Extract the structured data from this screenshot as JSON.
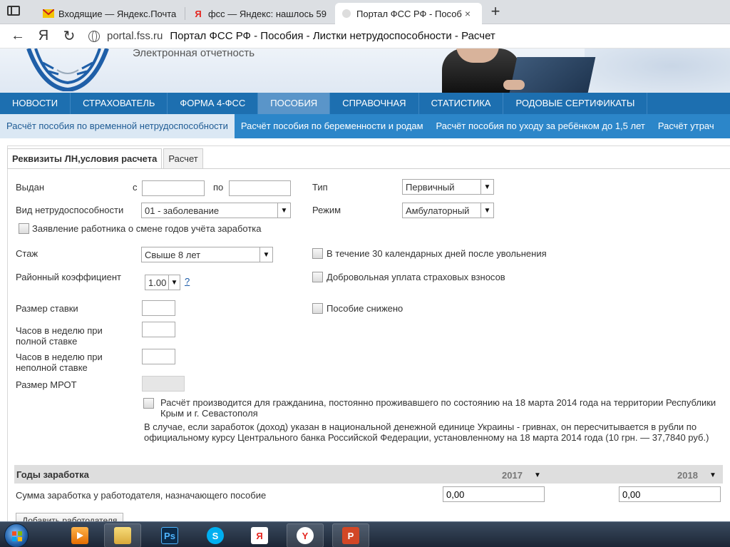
{
  "browser": {
    "tabs": [
      {
        "label": "Входящие — Яндекс.Почта",
        "icon": "yandex-mail-icon"
      },
      {
        "label": "фсс — Яндекс: нашлось 59",
        "icon": "yandex-icon"
      },
      {
        "label": "Портал ФСС РФ - Пособ",
        "icon": "page-icon",
        "close": "×"
      }
    ],
    "new_tab": "+",
    "yandex_button": "Я",
    "url_host": "portal.fss.ru",
    "page_title": "Портал ФСС РФ - Пособия - Листки нетрудоспособности - Расчет"
  },
  "site": {
    "subtitle": "Электронная отчетность"
  },
  "main_nav": [
    "НОВОСТИ",
    "СТРАХОВАТЕЛЬ",
    "ФОРМА 4-ФСС",
    "ПОСОБИЯ",
    "СПРАВОЧНАЯ",
    "СТАТИСТИКА",
    "РОДОВЫЕ СЕРТИФИКАТЫ"
  ],
  "sub_nav": [
    "Расчёт пособия по временной нетрудоспособности",
    "Расчёт пособия по беременности и родам",
    "Расчёт пособия по уходу за ребёнком до 1,5 лет",
    "Расчёт утрач"
  ],
  "form_tabs": [
    "Реквизиты ЛН,условия расчета",
    "Расчет"
  ],
  "form": {
    "issued_label": "Выдан",
    "from_label": "с",
    "to_label": "по",
    "from_value": "",
    "to_value": "",
    "type_label": "Тип",
    "type_value": "Первичный",
    "disability_label": "Вид нетрудоспособности",
    "disability_value": "01 - заболевание",
    "mode_label": "Режим",
    "mode_value": "Амбулаторный",
    "years_change_label": "Заявление работника о смене годов учёта заработка",
    "experience_label": "Стаж",
    "experience_value": "Свыше 8 лет",
    "within30_label": "В течение 30 календарных дней после увольнения",
    "regional_label": "Районный коэффициент",
    "regional_value": "1.00",
    "help_mark": "?",
    "voluntary_label": "Добровольная уплата страховых взносов",
    "rate_label": "Размер ставки",
    "reduced_label": "Пособие снижено",
    "hours_full_label": "Часов в неделю при полной ставке",
    "hours_part_label": "Часов в неделю при неполной ставке",
    "mrot_label": "Размер МРОТ",
    "crimea_label": "Расчёт производится для гражданина, постоянно проживавшего по состоянию на 18 марта 2014 года на территории Республики Крым и г. Севастополя",
    "crimea_note": "В случае, если заработок (доход) указан в национальной денежной единице Украины - гривнах, он пересчитывается в рубли по официальному курсу Центрального банка Российской Федерации, установленному на 18 марта 2014 года (10 грн. — 37,7840 руб.)"
  },
  "earnings": {
    "title": "Годы заработка",
    "year1": "2017",
    "year2": "2018",
    "row_label": "Сумма заработка у работодателя, назначающего пособие",
    "value1": "0,00",
    "value2": "0,00",
    "add_button": "Добавить работодателя"
  },
  "taskbar": {
    "apps": [
      "start-button",
      "media-player-icon",
      "file-explorer-icon",
      "photoshop-icon",
      "skype-icon",
      "yandex-icon",
      "yandex-browser-icon",
      "powerpoint-icon"
    ],
    "ps_text": "Ps",
    "yandex_text": "Я"
  }
}
